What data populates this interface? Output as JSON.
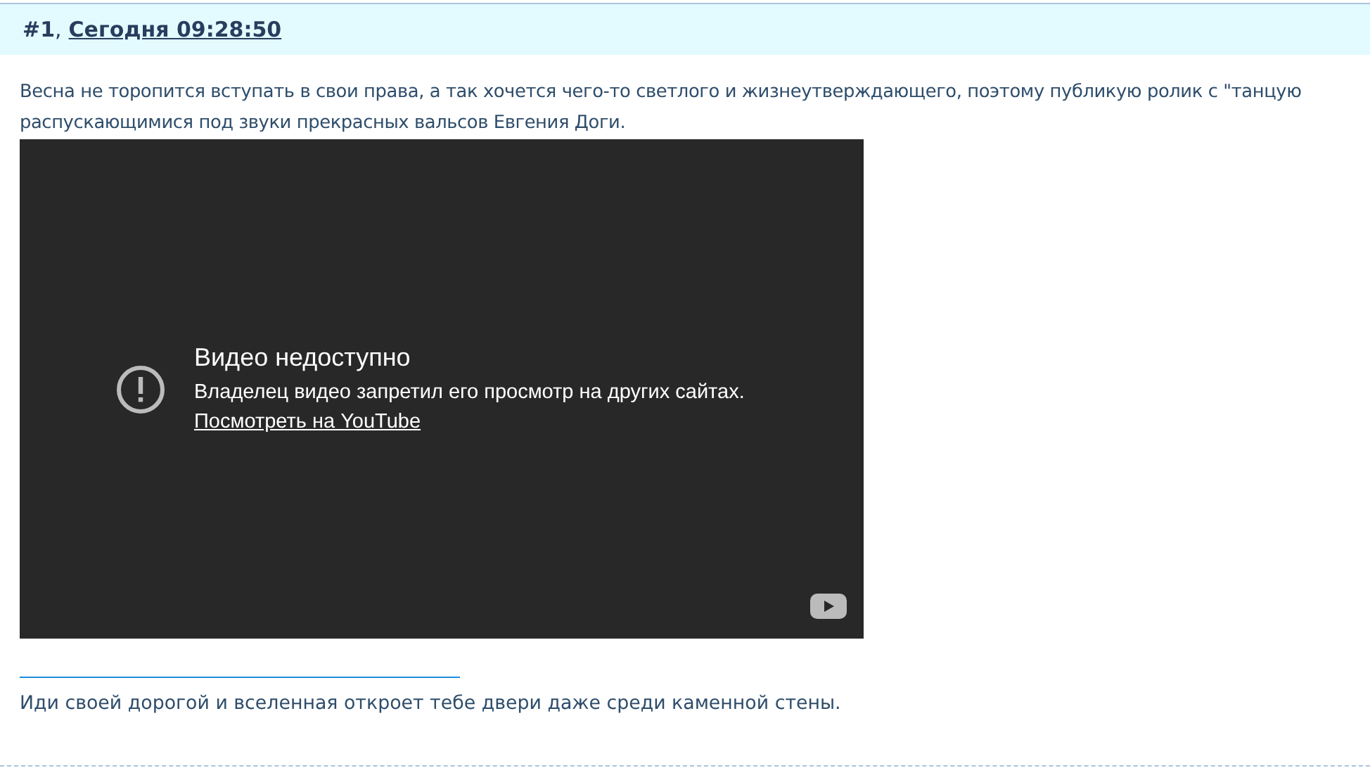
{
  "post": {
    "number": "#1",
    "separator": ",",
    "date": "Сегодня 09:28:50",
    "text_lines": [
      "Весна не торопится вступать в свои права, а так хочется чего-то светлого и жизнеутверждающего, поэтому публикую ролик с \"танцую",
      "распускающимися под звуки прекрасных вальсов Евгения Доги."
    ],
    "video": {
      "title": "Видео недоступно",
      "message": "Владелец видео запретил его просмотр на других сайтах.",
      "link": "Посмотреть на YouTube"
    },
    "signature": "Иди своей дорогой и вселенная откроет тебе двери даже среди каменной стены."
  }
}
